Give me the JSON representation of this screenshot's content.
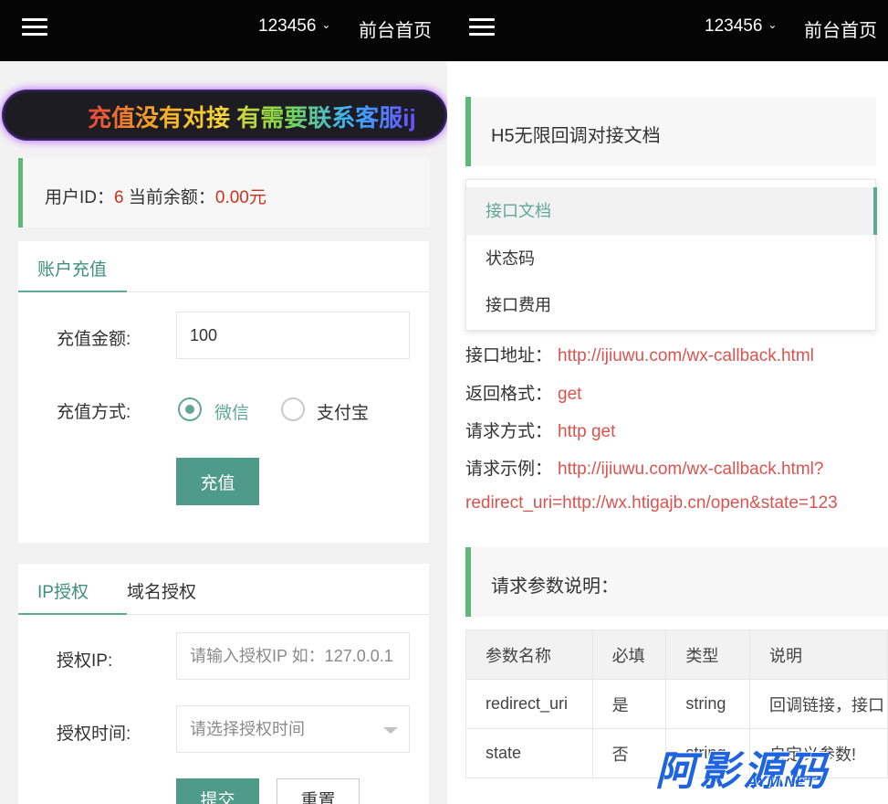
{
  "topbar": {
    "username": "123456",
    "home_link": "前台首页",
    "menu_icon": "hamburger-icon",
    "dropdown_icon": "chevron-down-icon"
  },
  "left": {
    "marquee": "充值没有对接 有需要联系客服ij",
    "userinfo": {
      "id_label": "用户ID：",
      "id_value": "6",
      "balance_label": " 当前余额：",
      "balance_value": "0.00元"
    },
    "recharge": {
      "tab": "账户充值",
      "amount_label": "充值金额:",
      "amount_value": "100",
      "method_label": "充值方式:",
      "method_options": [
        "微信",
        "支付宝"
      ],
      "method_selected": "微信",
      "submit": "充值"
    },
    "auth": {
      "tabs": [
        "IP授权",
        "域名授权"
      ],
      "ip_label": "授权IP:",
      "ip_placeholder": "请输入授权IP 如：127.0.0.1",
      "time_label": "授权时间:",
      "time_placeholder": "请选择授权时间",
      "submit": "提交",
      "reset": "重置"
    }
  },
  "right": {
    "doc_title": "H5无限回调对接文档",
    "menu": [
      "接口文档",
      "状态码",
      "接口费用"
    ],
    "menu_active": "接口文档",
    "fields": [
      {
        "label": "接口地址：",
        "value": "http://ijiuwu.com/wx-callback.html"
      },
      {
        "label": "返回格式：",
        "value": "get"
      },
      {
        "label": "请求方式：",
        "value": "http get"
      },
      {
        "label": "请求示例：",
        "value": "http://ijiuwu.com/wx-callback.html?"
      }
    ],
    "example_cont": "redirect_uri=http://wx.htigajb.cn/open&state=123",
    "param_title": "请求参数说明：",
    "table": {
      "headers": [
        "参数名称",
        "必填",
        "类型",
        "说明"
      ],
      "rows": [
        [
          "redirect_uri",
          "是",
          "string",
          "回调链接，接口"
        ],
        [
          "state",
          "否",
          "string",
          "自定义参数!"
        ]
      ]
    }
  },
  "watermark": {
    "main": "阿影源码",
    "sub": "AYM.NET"
  },
  "colors": {
    "topbar": "#050505",
    "accent": "#5fa893",
    "button": "#4e9b8a",
    "red_value": "#c8321e",
    "link_red": "#d9534f",
    "watermark": "#1e63e0"
  }
}
